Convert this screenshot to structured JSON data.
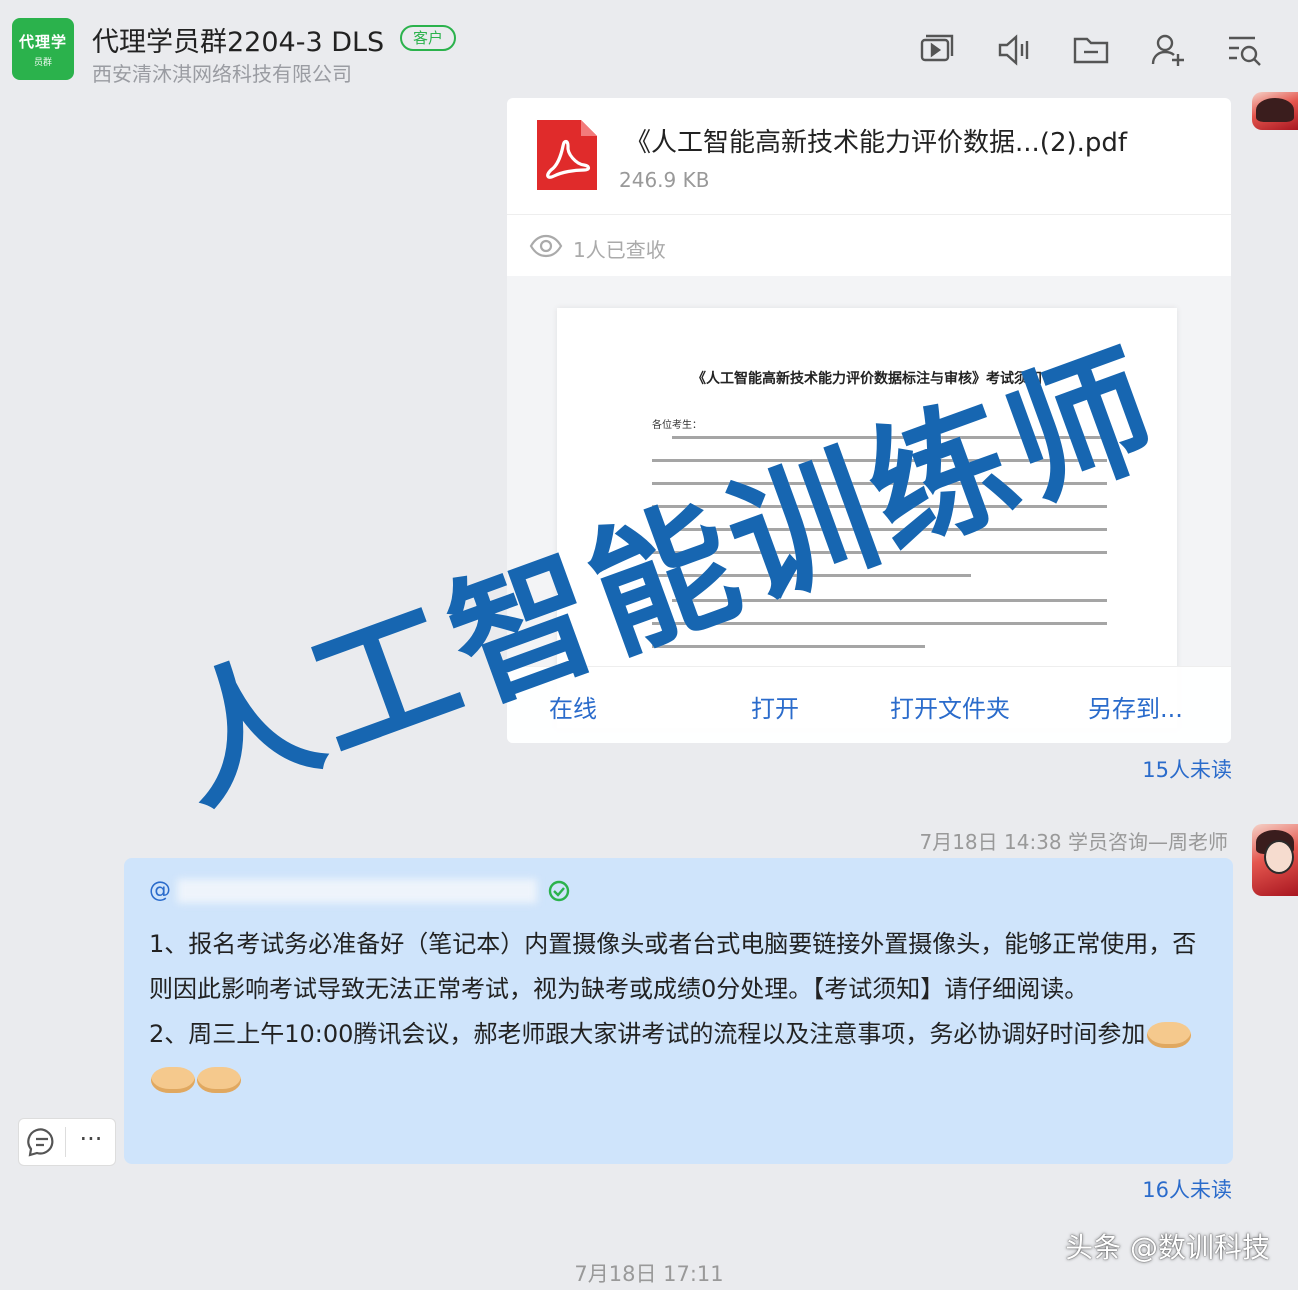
{
  "header": {
    "avatar_line1": "代理学",
    "avatar_line2": "员群",
    "title": "代理学员群2204-3 DLS",
    "badge": "客户",
    "subtitle": "西安清沐淇网络科技有限公司",
    "icons": [
      "screen-share-icon",
      "speaker-icon",
      "folder-icon",
      "add-member-icon",
      "search-history-icon"
    ]
  },
  "file_message": {
    "name": "《人工智能高新技术能力评价数据...(2).pdf",
    "size": "246.9 KB",
    "read_info": "1人已查收",
    "preview": {
      "doc_title": "《人工智能高新技术能力评价数据标注与审核》考试须知",
      "salutation": "各位考生："
    },
    "actions": [
      "在线",
      "打开",
      "打开文件夹",
      "另存到..."
    ],
    "unread": "15人未读"
  },
  "text_message": {
    "meta": "7月18日 14:38  学员咨询—周老师",
    "mention": "@",
    "paragraph1": "1、报名考试务必准备好（笔记本）内置摄像头或者台式电脑要链接外置摄像头，能够正常使用，否则因此影响考试导致无法正常考试，视为缺考或成绩0分处理。【考试须知】请仔细阅读。",
    "paragraph2": "2、周三上午10:00腾讯会议，郝老师跟大家讲考试的流程以及注意事项，务必协调好时间参加",
    "unread": "16人未读"
  },
  "bubble_tools": {
    "more": "···"
  },
  "footer_time": "7月18日 17:11",
  "watermark": "人工智能训练师",
  "source_mark": "头条 @数训科技",
  "colors": {
    "brand_green": "#2bb24c",
    "link_blue": "#2a6bcb",
    "bubble_blue": "#cfe4fb",
    "watermark_blue": "#1766b1",
    "pdf_red": "#e02b2b"
  }
}
